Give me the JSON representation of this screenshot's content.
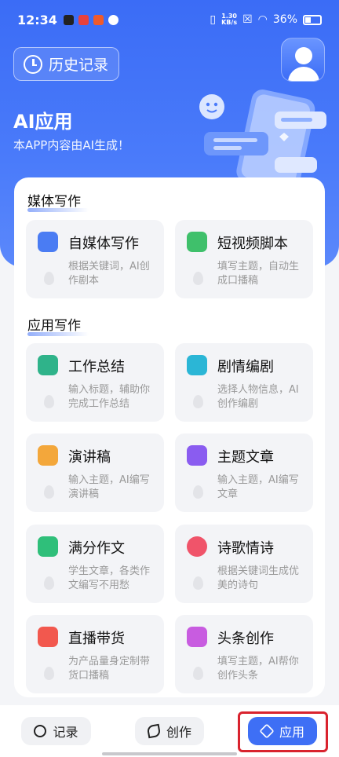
{
  "status": {
    "time": "12:34",
    "speed_top": "1.30",
    "speed_unit": "KB/s",
    "battery": "36%"
  },
  "header": {
    "history_label": "历史记录",
    "title": "AI应用",
    "subtitle": "本APP内容由AI生成！"
  },
  "sections": [
    {
      "title": "媒体写作",
      "cards": [
        {
          "title": "自媒体写作",
          "desc": "根据关键词，AI创作剧本",
          "icon": "text-icon",
          "color": "#4a7cf3"
        },
        {
          "title": "短视频脚本",
          "desc": "填写主题，自动生成口播稿",
          "icon": "video-icon",
          "color": "#3fc06b"
        }
      ]
    },
    {
      "title": "应用写作",
      "cards": [
        {
          "title": "工作总结",
          "desc": "输入标题，辅助你完成工作总结",
          "icon": "briefcase-icon",
          "color": "#2fb38a"
        },
        {
          "title": "剧情编剧",
          "desc": "选择人物信息，AI创作编剧",
          "icon": "play-icon",
          "color": "#2bb6d6"
        },
        {
          "title": "演讲稿",
          "desc": "输入主题，AI编写演讲稿",
          "icon": "megaphone-icon",
          "color": "#f3a73b"
        },
        {
          "title": "主题文章",
          "desc": "输入主题，AI编写文章",
          "icon": "article-icon",
          "color": "#8a5cf0"
        },
        {
          "title": "满分作文",
          "desc": "学生文章，各类作文编写不用愁",
          "icon": "checklist-icon",
          "color": "#2fbf7a"
        },
        {
          "title": "诗歌情诗",
          "desc": "根据关键词生成优美的诗句",
          "icon": "heart-icon",
          "color": "#f0546a"
        },
        {
          "title": "直播带货",
          "desc": "为产品量身定制带货口播稿",
          "icon": "bag-icon",
          "color": "#f2584e"
        },
        {
          "title": "头条创作",
          "desc": "填写主题，AI帮你创作头条",
          "icon": "pen-icon",
          "color": "#c85ce0"
        }
      ]
    }
  ],
  "tabs": [
    {
      "label": "记录",
      "icon": "chat-icon"
    },
    {
      "label": "创作",
      "icon": "leaf-icon"
    },
    {
      "label": "应用",
      "icon": "layers-icon",
      "active": true
    }
  ]
}
